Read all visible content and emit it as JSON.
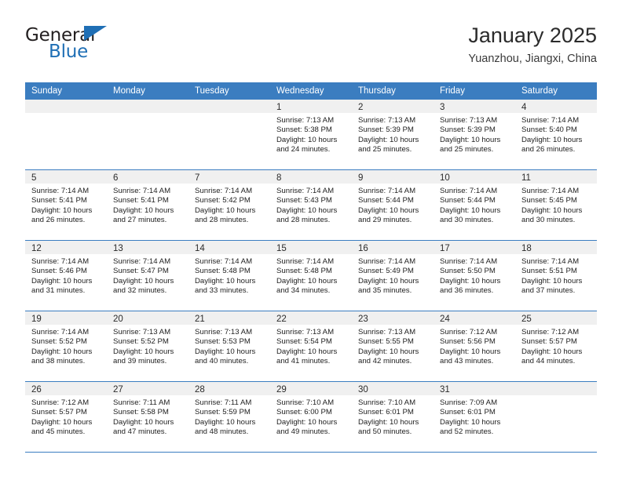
{
  "brand": {
    "word1": "General",
    "word2": "Blue",
    "triangle_icon": "triangle-icon",
    "accent_color": "#1f6fb5"
  },
  "header": {
    "title": "January 2025",
    "subtitle": "Yuanzhou, Jiangxi, China"
  },
  "calendar": {
    "header_color": "#3b7dc0",
    "daynum_band_color": "#f0f0f0",
    "day_names": [
      "Sunday",
      "Monday",
      "Tuesday",
      "Wednesday",
      "Thursday",
      "Friday",
      "Saturday"
    ],
    "weeks": [
      [
        {
          "day": "",
          "sunrise": "",
          "sunset": "",
          "daylight": ""
        },
        {
          "day": "",
          "sunrise": "",
          "sunset": "",
          "daylight": ""
        },
        {
          "day": "",
          "sunrise": "",
          "sunset": "",
          "daylight": ""
        },
        {
          "day": "1",
          "sunrise": "Sunrise: 7:13 AM",
          "sunset": "Sunset: 5:38 PM",
          "daylight": "Daylight: 10 hours and 24 minutes."
        },
        {
          "day": "2",
          "sunrise": "Sunrise: 7:13 AM",
          "sunset": "Sunset: 5:39 PM",
          "daylight": "Daylight: 10 hours and 25 minutes."
        },
        {
          "day": "3",
          "sunrise": "Sunrise: 7:13 AM",
          "sunset": "Sunset: 5:39 PM",
          "daylight": "Daylight: 10 hours and 25 minutes."
        },
        {
          "day": "4",
          "sunrise": "Sunrise: 7:14 AM",
          "sunset": "Sunset: 5:40 PM",
          "daylight": "Daylight: 10 hours and 26 minutes."
        }
      ],
      [
        {
          "day": "5",
          "sunrise": "Sunrise: 7:14 AM",
          "sunset": "Sunset: 5:41 PM",
          "daylight": "Daylight: 10 hours and 26 minutes."
        },
        {
          "day": "6",
          "sunrise": "Sunrise: 7:14 AM",
          "sunset": "Sunset: 5:41 PM",
          "daylight": "Daylight: 10 hours and 27 minutes."
        },
        {
          "day": "7",
          "sunrise": "Sunrise: 7:14 AM",
          "sunset": "Sunset: 5:42 PM",
          "daylight": "Daylight: 10 hours and 28 minutes."
        },
        {
          "day": "8",
          "sunrise": "Sunrise: 7:14 AM",
          "sunset": "Sunset: 5:43 PM",
          "daylight": "Daylight: 10 hours and 28 minutes."
        },
        {
          "day": "9",
          "sunrise": "Sunrise: 7:14 AM",
          "sunset": "Sunset: 5:44 PM",
          "daylight": "Daylight: 10 hours and 29 minutes."
        },
        {
          "day": "10",
          "sunrise": "Sunrise: 7:14 AM",
          "sunset": "Sunset: 5:44 PM",
          "daylight": "Daylight: 10 hours and 30 minutes."
        },
        {
          "day": "11",
          "sunrise": "Sunrise: 7:14 AM",
          "sunset": "Sunset: 5:45 PM",
          "daylight": "Daylight: 10 hours and 30 minutes."
        }
      ],
      [
        {
          "day": "12",
          "sunrise": "Sunrise: 7:14 AM",
          "sunset": "Sunset: 5:46 PM",
          "daylight": "Daylight: 10 hours and 31 minutes."
        },
        {
          "day": "13",
          "sunrise": "Sunrise: 7:14 AM",
          "sunset": "Sunset: 5:47 PM",
          "daylight": "Daylight: 10 hours and 32 minutes."
        },
        {
          "day": "14",
          "sunrise": "Sunrise: 7:14 AM",
          "sunset": "Sunset: 5:48 PM",
          "daylight": "Daylight: 10 hours and 33 minutes."
        },
        {
          "day": "15",
          "sunrise": "Sunrise: 7:14 AM",
          "sunset": "Sunset: 5:48 PM",
          "daylight": "Daylight: 10 hours and 34 minutes."
        },
        {
          "day": "16",
          "sunrise": "Sunrise: 7:14 AM",
          "sunset": "Sunset: 5:49 PM",
          "daylight": "Daylight: 10 hours and 35 minutes."
        },
        {
          "day": "17",
          "sunrise": "Sunrise: 7:14 AM",
          "sunset": "Sunset: 5:50 PM",
          "daylight": "Daylight: 10 hours and 36 minutes."
        },
        {
          "day": "18",
          "sunrise": "Sunrise: 7:14 AM",
          "sunset": "Sunset: 5:51 PM",
          "daylight": "Daylight: 10 hours and 37 minutes."
        }
      ],
      [
        {
          "day": "19",
          "sunrise": "Sunrise: 7:14 AM",
          "sunset": "Sunset: 5:52 PM",
          "daylight": "Daylight: 10 hours and 38 minutes."
        },
        {
          "day": "20",
          "sunrise": "Sunrise: 7:13 AM",
          "sunset": "Sunset: 5:52 PM",
          "daylight": "Daylight: 10 hours and 39 minutes."
        },
        {
          "day": "21",
          "sunrise": "Sunrise: 7:13 AM",
          "sunset": "Sunset: 5:53 PM",
          "daylight": "Daylight: 10 hours and 40 minutes."
        },
        {
          "day": "22",
          "sunrise": "Sunrise: 7:13 AM",
          "sunset": "Sunset: 5:54 PM",
          "daylight": "Daylight: 10 hours and 41 minutes."
        },
        {
          "day": "23",
          "sunrise": "Sunrise: 7:13 AM",
          "sunset": "Sunset: 5:55 PM",
          "daylight": "Daylight: 10 hours and 42 minutes."
        },
        {
          "day": "24",
          "sunrise": "Sunrise: 7:12 AM",
          "sunset": "Sunset: 5:56 PM",
          "daylight": "Daylight: 10 hours and 43 minutes."
        },
        {
          "day": "25",
          "sunrise": "Sunrise: 7:12 AM",
          "sunset": "Sunset: 5:57 PM",
          "daylight": "Daylight: 10 hours and 44 minutes."
        }
      ],
      [
        {
          "day": "26",
          "sunrise": "Sunrise: 7:12 AM",
          "sunset": "Sunset: 5:57 PM",
          "daylight": "Daylight: 10 hours and 45 minutes."
        },
        {
          "day": "27",
          "sunrise": "Sunrise: 7:11 AM",
          "sunset": "Sunset: 5:58 PM",
          "daylight": "Daylight: 10 hours and 47 minutes."
        },
        {
          "day": "28",
          "sunrise": "Sunrise: 7:11 AM",
          "sunset": "Sunset: 5:59 PM",
          "daylight": "Daylight: 10 hours and 48 minutes."
        },
        {
          "day": "29",
          "sunrise": "Sunrise: 7:10 AM",
          "sunset": "Sunset: 6:00 PM",
          "daylight": "Daylight: 10 hours and 49 minutes."
        },
        {
          "day": "30",
          "sunrise": "Sunrise: 7:10 AM",
          "sunset": "Sunset: 6:01 PM",
          "daylight": "Daylight: 10 hours and 50 minutes."
        },
        {
          "day": "31",
          "sunrise": "Sunrise: 7:09 AM",
          "sunset": "Sunset: 6:01 PM",
          "daylight": "Daylight: 10 hours and 52 minutes."
        },
        {
          "day": "",
          "sunrise": "",
          "sunset": "",
          "daylight": ""
        }
      ]
    ]
  }
}
